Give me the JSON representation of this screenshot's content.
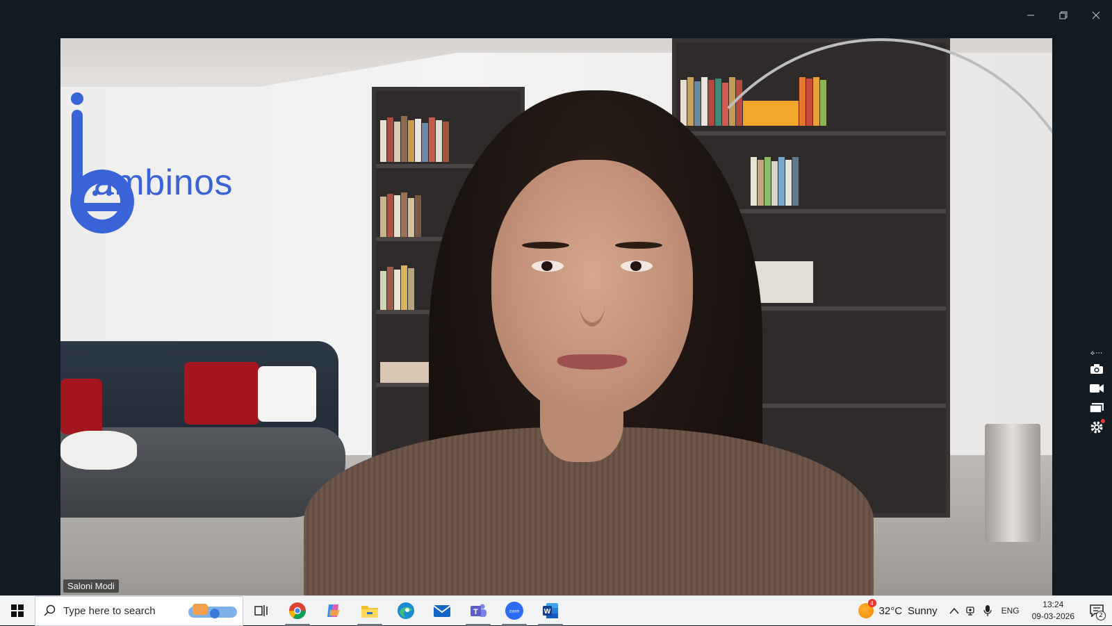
{
  "window": {
    "controls": {
      "minimize_icon": "minimize-icon",
      "restore_icon": "restore-icon",
      "close_icon": "close-icon"
    }
  },
  "video": {
    "participant_name": "Saloni Modi",
    "background_logo_text": "ambinos"
  },
  "side_tools": {
    "items": [
      "more-options-icon",
      "camera-icon",
      "video-icon",
      "screen-share-icon",
      "settings-icon"
    ]
  },
  "taskbar": {
    "start_icon": "windows-start-icon",
    "search": {
      "placeholder": "Type here to search"
    },
    "apps": [
      {
        "name": "task-view",
        "icon": "task-view-icon",
        "active": false
      },
      {
        "name": "chrome",
        "icon": "chrome-icon",
        "active": true,
        "color": "#db4437"
      },
      {
        "name": "copilot",
        "icon": "copilot-icon",
        "active": false,
        "color": "#8a5cf6"
      },
      {
        "name": "file-explorer",
        "icon": "folder-icon",
        "active": true,
        "color": "#f2c230"
      },
      {
        "name": "edge",
        "icon": "edge-icon",
        "active": false,
        "color": "#1a8ad4"
      },
      {
        "name": "mail",
        "icon": "mail-icon",
        "active": false,
        "color": "#1466c4"
      },
      {
        "name": "teams",
        "icon": "teams-icon",
        "active": true,
        "color": "#5b5fc7"
      },
      {
        "name": "zoom",
        "icon": "zoom-icon",
        "active": true,
        "color": "#2d6bf5"
      },
      {
        "name": "word",
        "icon": "word-icon",
        "active": true,
        "color": "#2b579a"
      }
    ],
    "weather": {
      "temp": "32°C",
      "condition": "Sunny",
      "alert_count": "4"
    },
    "language": "ENG",
    "clock": {
      "time": "13:24",
      "date": "09-03-2026"
    },
    "notifications_count": "2"
  },
  "colors": {
    "accent": "#3b63d8",
    "taskbar_bg": "#f1f3f5",
    "window_bg": "#121a22"
  }
}
